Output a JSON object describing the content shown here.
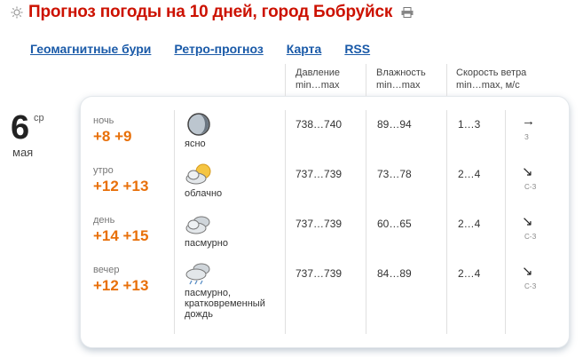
{
  "header": {
    "title": "Прогноз погоды на 10 дней, город Бобруйск",
    "sun_icon": "sun-icon",
    "print_icon": "printer-icon"
  },
  "nav": {
    "links": [
      "Геомагнитные бури",
      "Ретро-прогноз",
      "Карта",
      "RSS"
    ]
  },
  "columns": {
    "pressure": [
      "Давление",
      "min…max"
    ],
    "humidity": [
      "Влажность",
      "min…max"
    ],
    "wind": [
      "Скорость ветра",
      "min…max, м/с"
    ]
  },
  "date": {
    "day": "6",
    "weekday": "ср",
    "month": "мая"
  },
  "rows": [
    {
      "period": "ночь",
      "temp": "+8 +9",
      "icon": "moon-clear-icon",
      "condition": "ясно",
      "pressure": "738…740",
      "humidity": "89…94",
      "wind": "1…3",
      "arrow": "→",
      "direction": "З"
    },
    {
      "period": "утро",
      "temp": "+12 +13",
      "icon": "partly-cloudy-icon",
      "condition": "облачно",
      "pressure": "737…739",
      "humidity": "73…78",
      "wind": "2…4",
      "arrow": "↘",
      "direction": "С-З"
    },
    {
      "period": "день",
      "temp": "+14 +15",
      "icon": "overcast-icon",
      "condition": "пасмурно",
      "pressure": "737…739",
      "humidity": "60…65",
      "wind": "2…4",
      "arrow": "↘",
      "direction": "С-З"
    },
    {
      "period": "вечер",
      "temp": "+12 +13",
      "icon": "rain-cloud-icon",
      "condition": "пасмурно, кратковременный дождь",
      "pressure": "737…739",
      "humidity": "84…89",
      "wind": "2…4",
      "arrow": "↘",
      "direction": "С-З"
    }
  ]
}
